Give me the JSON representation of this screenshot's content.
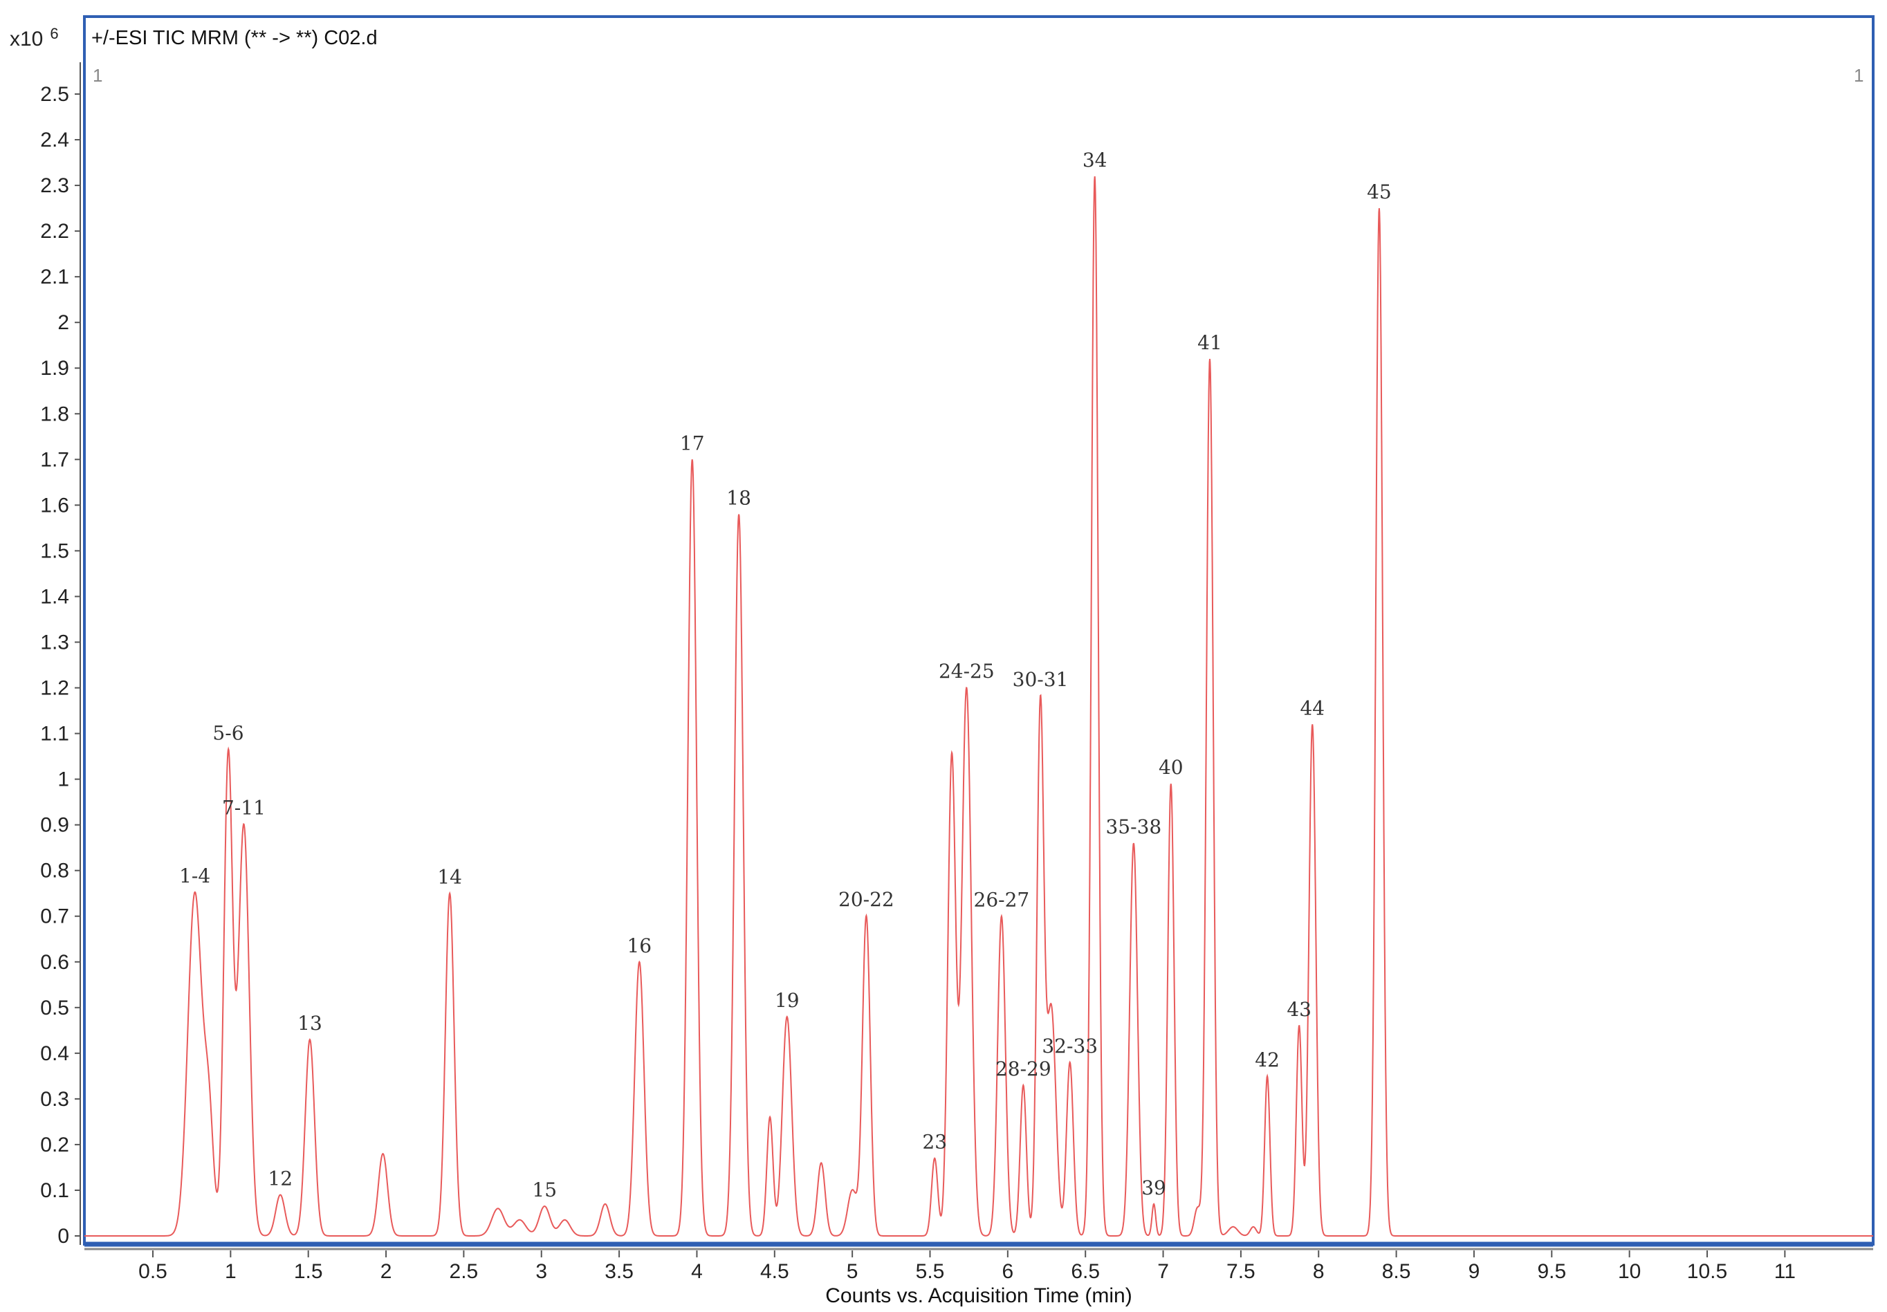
{
  "chart_data": {
    "type": "line",
    "title": "+/-ESI TIC MRM (** -> **) C02.d",
    "xlabel": "Counts vs. Acquisition Time (min)",
    "ylabel_multiplier": "x10",
    "ylabel_exponent": "6",
    "corner_left": "1",
    "corner_right": "1",
    "xlim": [
      0.06,
      11.57
    ],
    "ylim": [
      0,
      2.58
    ],
    "xticks": [
      "0.5",
      "1",
      "1.5",
      "2",
      "2.5",
      "3",
      "3.5",
      "4",
      "4.5",
      "5",
      "5.5",
      "6",
      "6.5",
      "7",
      "7.5",
      "8",
      "8.5",
      "9",
      "9.5",
      "10",
      "10.5",
      "11"
    ],
    "yticks": [
      "0",
      "0.1",
      "0.2",
      "0.3",
      "0.4",
      "0.5",
      "0.6",
      "0.7",
      "0.8",
      "0.9",
      "1",
      "1.1",
      "1.2",
      "1.3",
      "1.4",
      "1.5",
      "1.6",
      "1.7",
      "1.8",
      "1.9",
      "2",
      "2.1",
      "2.2",
      "2.3",
      "2.4",
      "2.5"
    ],
    "series_color": "#e85a5a",
    "frame_color": "#2f5fb3",
    "peaks": [
      {
        "t": 0.77,
        "h": 0.75,
        "w": 0.045,
        "label": "1-4"
      },
      {
        "t": 0.86,
        "h": 0.25,
        "w": 0.03,
        "label": ""
      },
      {
        "t": 0.985,
        "h": 1.05,
        "w": 0.028,
        "label": "5-6"
      },
      {
        "t": 1.085,
        "h": 0.9,
        "w": 0.035,
        "label": "7-11"
      },
      {
        "t": 1.32,
        "h": 0.09,
        "w": 0.03,
        "label": "12"
      },
      {
        "t": 1.51,
        "h": 0.43,
        "w": 0.03,
        "label": "13"
      },
      {
        "t": 1.98,
        "h": 0.18,
        "w": 0.03,
        "label": ""
      },
      {
        "t": 2.41,
        "h": 0.75,
        "w": 0.028,
        "label": "14"
      },
      {
        "t": 2.72,
        "h": 0.06,
        "w": 0.04,
        "label": ""
      },
      {
        "t": 2.86,
        "h": 0.035,
        "w": 0.04,
        "label": ""
      },
      {
        "t": 3.02,
        "h": 0.065,
        "w": 0.035,
        "label": "15"
      },
      {
        "t": 3.15,
        "h": 0.035,
        "w": 0.035,
        "label": ""
      },
      {
        "t": 3.41,
        "h": 0.07,
        "w": 0.03,
        "label": ""
      },
      {
        "t": 3.63,
        "h": 0.6,
        "w": 0.03,
        "label": "16"
      },
      {
        "t": 3.97,
        "h": 1.7,
        "w": 0.028,
        "label": "17"
      },
      {
        "t": 4.27,
        "h": 1.58,
        "w": 0.028,
        "label": "18"
      },
      {
        "t": 4.47,
        "h": 0.26,
        "w": 0.02,
        "label": ""
      },
      {
        "t": 4.58,
        "h": 0.48,
        "w": 0.03,
        "label": "19"
      },
      {
        "t": 4.8,
        "h": 0.16,
        "w": 0.025,
        "label": ""
      },
      {
        "t": 5.0,
        "h": 0.1,
        "w": 0.03,
        "label": ""
      },
      {
        "t": 5.09,
        "h": 0.7,
        "w": 0.025,
        "label": "20-22"
      },
      {
        "t": 5.53,
        "h": 0.17,
        "w": 0.02,
        "label": "23"
      },
      {
        "t": 5.64,
        "h": 1.05,
        "w": 0.025,
        "label": ""
      },
      {
        "t": 5.735,
        "h": 1.2,
        "w": 0.03,
        "label": "24-25"
      },
      {
        "t": 5.96,
        "h": 0.7,
        "w": 0.025,
        "label": "26-27"
      },
      {
        "t": 6.1,
        "h": 0.33,
        "w": 0.02,
        "label": "28-29"
      },
      {
        "t": 6.21,
        "h": 1.15,
        "w": 0.022,
        "label": "30-31"
      },
      {
        "t": 6.28,
        "h": 0.5,
        "w": 0.03,
        "label": ""
      },
      {
        "t": 6.4,
        "h": 0.38,
        "w": 0.022,
        "label": "32-33"
      },
      {
        "t": 6.56,
        "h": 2.32,
        "w": 0.022,
        "label": "34"
      },
      {
        "t": 6.81,
        "h": 0.86,
        "w": 0.025,
        "label": "35-38"
      },
      {
        "t": 6.94,
        "h": 0.07,
        "w": 0.012,
        "label": "39"
      },
      {
        "t": 7.05,
        "h": 0.99,
        "w": 0.02,
        "label": "40"
      },
      {
        "t": 7.22,
        "h": 0.06,
        "w": 0.02,
        "label": ""
      },
      {
        "t": 7.3,
        "h": 1.92,
        "w": 0.022,
        "label": "41"
      },
      {
        "t": 7.45,
        "h": 0.02,
        "w": 0.03,
        "label": ""
      },
      {
        "t": 7.58,
        "h": 0.02,
        "w": 0.02,
        "label": ""
      },
      {
        "t": 7.67,
        "h": 0.35,
        "w": 0.017,
        "label": "42"
      },
      {
        "t": 7.875,
        "h": 0.46,
        "w": 0.018,
        "label": "43"
      },
      {
        "t": 7.96,
        "h": 1.12,
        "w": 0.022,
        "label": "44"
      },
      {
        "t": 8.39,
        "h": 2.25,
        "w": 0.022,
        "label": "45"
      }
    ]
  }
}
